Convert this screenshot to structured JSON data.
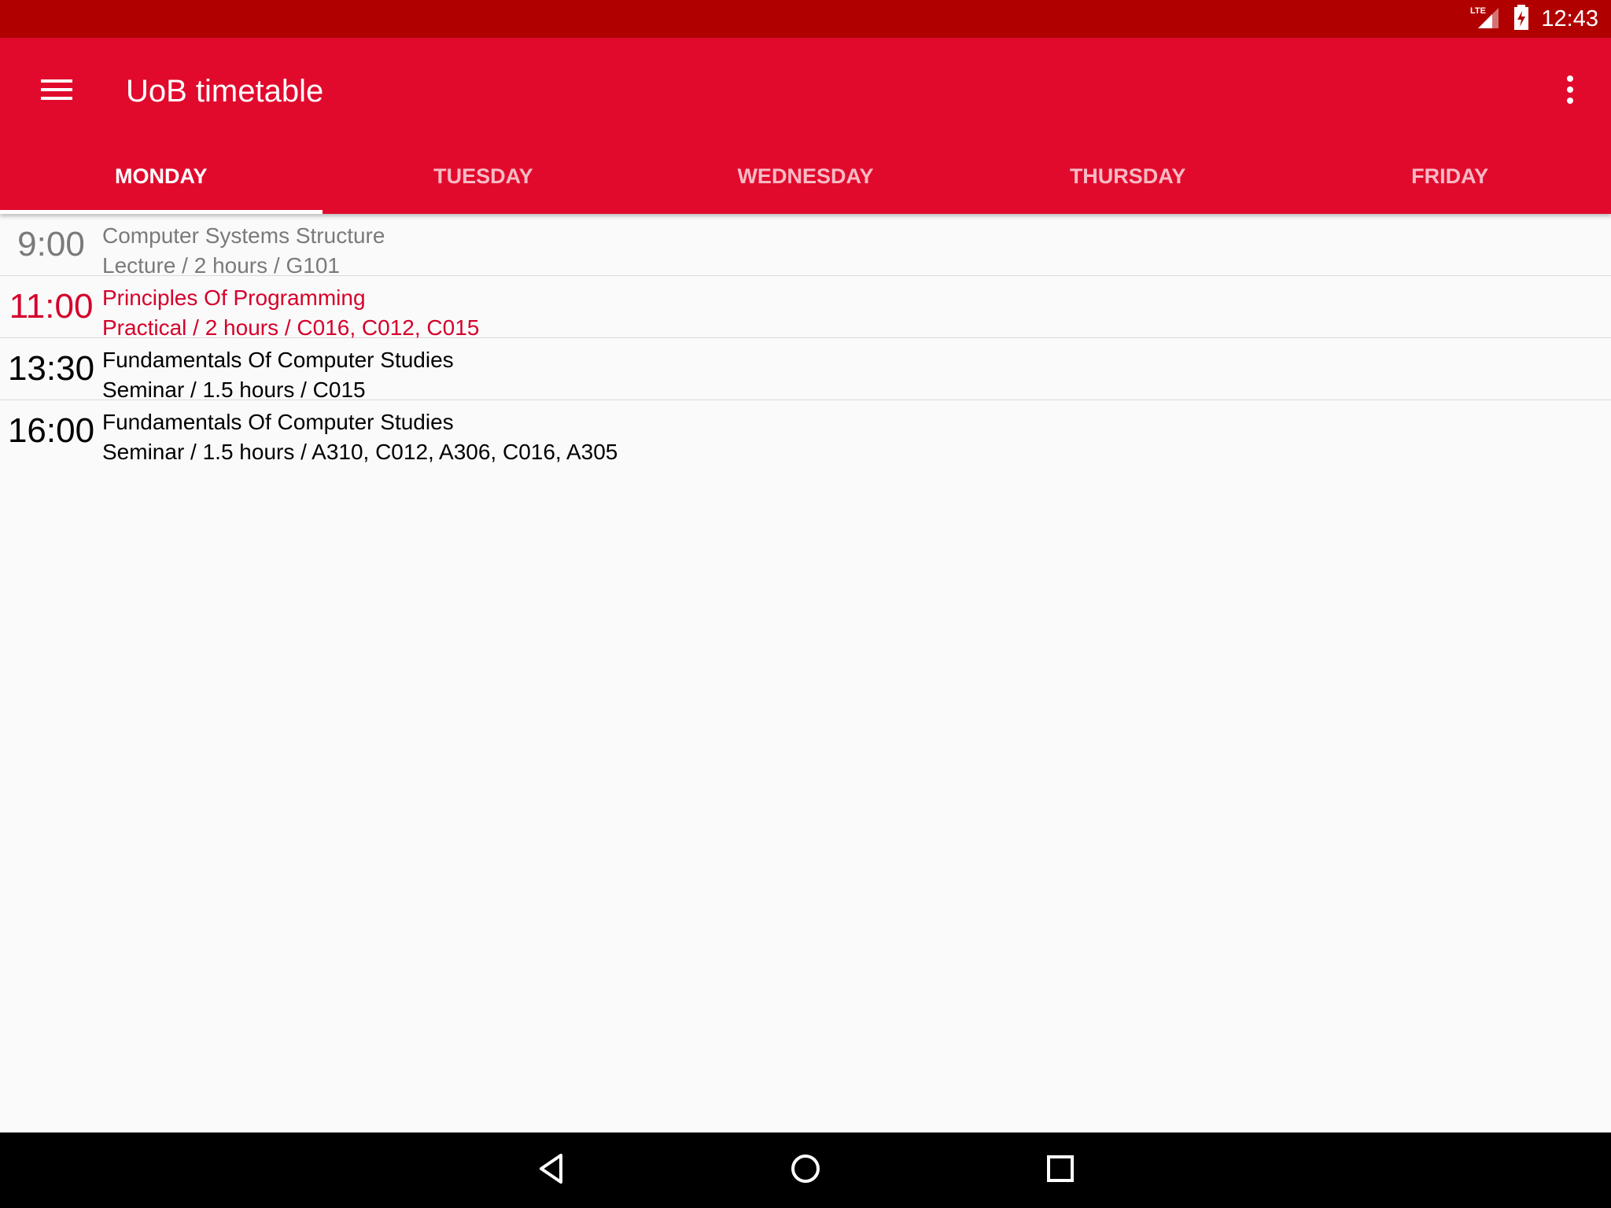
{
  "status_bar": {
    "time": "12:43",
    "network": "LTE",
    "icons": [
      "lte-signal-icon",
      "battery-charging-icon"
    ]
  },
  "app_bar": {
    "title": "UoB timetable",
    "icons": [
      "menu-icon",
      "overflow-menu-icon"
    ]
  },
  "tabs": [
    {
      "label": "MONDAY",
      "active": true
    },
    {
      "label": "TUESDAY",
      "active": false
    },
    {
      "label": "WEDNESDAY",
      "active": false
    },
    {
      "label": "THURSDAY",
      "active": false
    },
    {
      "label": "FRIDAY",
      "active": false
    }
  ],
  "sessions": [
    {
      "time": "9:00",
      "title": "Computer Systems Structure",
      "detail": "Lecture / 2 hours / G101",
      "state": "past"
    },
    {
      "time": "11:00",
      "title": "Principles Of Programming",
      "detail": "Practical / 2 hours / C016, C012, C015",
      "state": "current"
    },
    {
      "time": "13:30",
      "title": "Fundamentals Of Computer Studies",
      "detail": "Seminar / 1.5 hours / C015",
      "state": "upcoming"
    },
    {
      "time": "16:00",
      "title": "Fundamentals Of Computer Studies",
      "detail": "Seminar / 1.5 hours / A310, C012, A306, C016, A305",
      "state": "upcoming"
    }
  ],
  "nav_bar": {
    "icons": [
      "back-icon",
      "home-icon",
      "recents-icon"
    ]
  },
  "colors": {
    "status_bar": "#B10000",
    "app_bar": "#E10A2D",
    "current_session": "#D5002B",
    "past_session": "#7A7A7A",
    "background": "#FAFAFA"
  }
}
